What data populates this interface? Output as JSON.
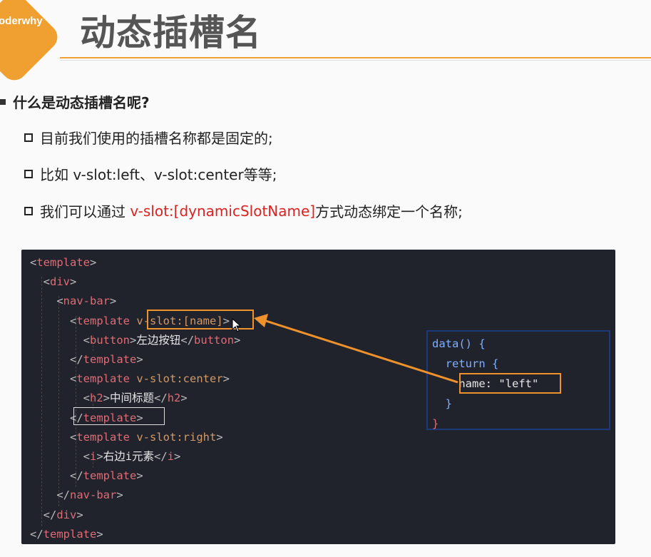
{
  "header": {
    "logo_text": "oderwhy",
    "title": "动态插槽名"
  },
  "content": {
    "heading": "什么是动态插槽名呢?",
    "bullets": [
      {
        "text": "目前我们使用的插槽名称都是固定的;"
      },
      {
        "text": "比如 v-slot:left、v-slot:center等等;"
      },
      {
        "prefix": "我们可以通过 ",
        "highlight": "v-slot:[dynamicSlotName]",
        "suffix": "方式动态绑定一个名称;"
      }
    ]
  },
  "code": {
    "lines": [
      "<template>",
      "  <div>",
      "    <nav-bar>",
      "      <template v-slot:[name]>",
      "        <button>左边按钮</button>",
      "      </template>",
      "      <template v-slot:center>",
      "        <h2>中间标题</h2>",
      "      </template>",
      "      <template v-slot:right>",
      "        <i>右边i元素</i>",
      "      </template>",
      "    </nav-bar>",
      "  </div>",
      "</template>"
    ],
    "panel_lines": [
      "data() {",
      "  return {",
      "    name: \"left\"",
      "  }",
      "}"
    ]
  },
  "colors": {
    "accent": "#f0a030",
    "highlight_box": "#f0922b",
    "highlight_text": "#dd2222",
    "code_bg": "#20222c",
    "panel_border": "#1c3a7a"
  }
}
